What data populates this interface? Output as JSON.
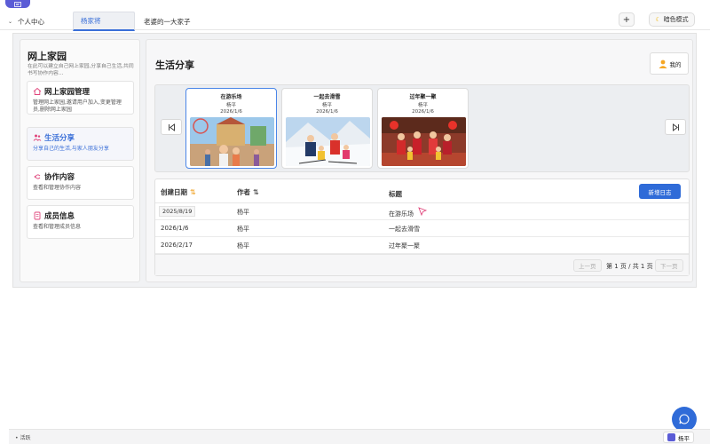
{
  "tabs": {
    "home": "个人中心",
    "active": "杨家将",
    "family": "老婆的一大家子",
    "plus": "+",
    "dark_mode": "暗色模式"
  },
  "sidebar": {
    "title": "网上家园",
    "description": "在此可以建立自己网上家园,分享自己生活,共同书写协作内容...",
    "items": [
      {
        "label": "网上家园管理",
        "desc": "管理网上家园,邀请用户加入,变更管理员,删除网上家园",
        "icon": "home-icon"
      },
      {
        "label": "生活分享",
        "desc": "分享自己的生活,与家人朋友分享",
        "icon": "people-icon"
      },
      {
        "label": "协作内容",
        "desc": "查看和管理协作内容",
        "icon": "collab-icon"
      },
      {
        "label": "成员信息",
        "desc": "查看和管理成员信息",
        "icon": "member-icon"
      }
    ]
  },
  "main": {
    "title": "生活分享",
    "mine_label": "我的",
    "posts": [
      {
        "title": "在游乐场",
        "author": "杨平",
        "date": "2026/1/6"
      },
      {
        "title": "一起去滑雪",
        "author": "杨平",
        "date": "2026/1/6"
      },
      {
        "title": "过年聚一聚",
        "author": "杨平",
        "date": "2026/1/6"
      }
    ],
    "table": {
      "headers": {
        "date": "创建日期",
        "author": "作者",
        "title": "标题"
      },
      "add_label": "新增日志",
      "rows": [
        {
          "date": "2025/8/19",
          "author": "杨平",
          "title": "在游乐场"
        },
        {
          "date": "2026/1/6",
          "author": "杨平",
          "title": "一起去滑雪"
        },
        {
          "date": "2026/2/17",
          "author": "杨平",
          "title": "过年聚一聚"
        }
      ],
      "prev": "上一页",
      "page_info": "第 1 页 / 共 1 页",
      "next": "下一页"
    }
  },
  "bottom": {
    "active_label": "活跃",
    "user": "杨平"
  },
  "colors": {
    "accent": "#2f6bd8",
    "brand": "#5b5cd6",
    "sort": "#f0a020"
  }
}
